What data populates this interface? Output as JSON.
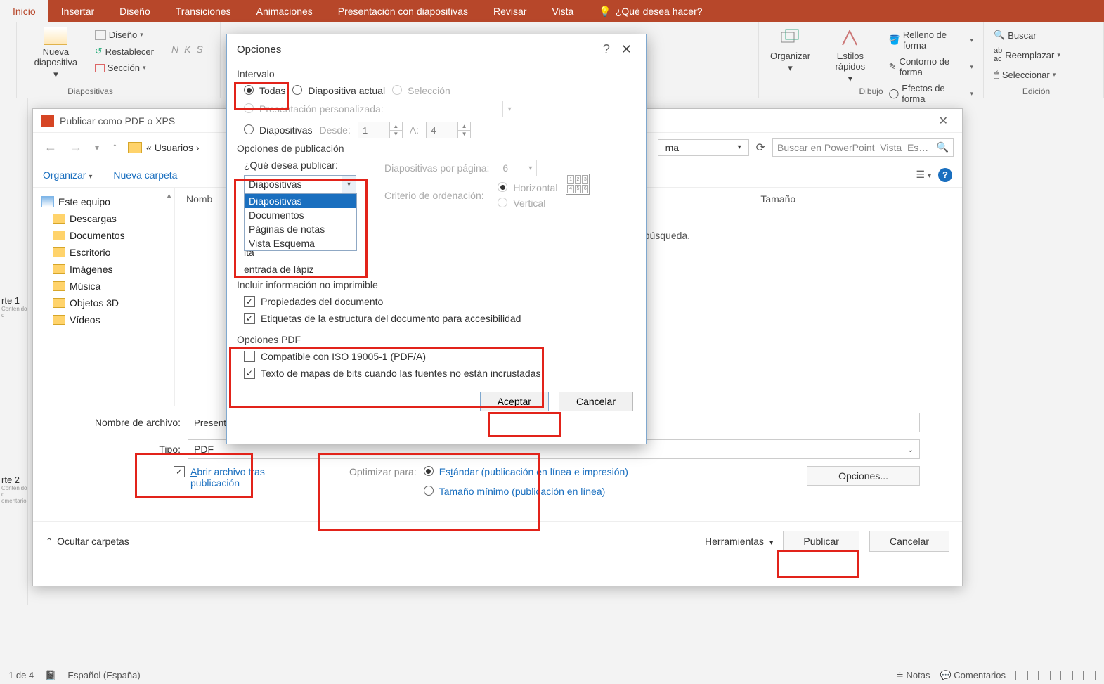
{
  "ribbon": {
    "tabs": [
      "Inicio",
      "Insertar",
      "Diseño",
      "Transiciones",
      "Animaciones",
      "Presentación con diapositivas",
      "Revisar",
      "Vista"
    ],
    "tellme": "¿Qué desea hacer?",
    "slides_group": "Diapositivas",
    "drawing_group": "Dibujo",
    "editing_group": "Edición",
    "new_slide": "Nueva diapositiva",
    "layout": "Diseño",
    "reset": "Restablecer",
    "section": "Sección",
    "organize": "Organizar",
    "quick_styles": "Estilos rápidos",
    "shape_fill": "Relleno de forma",
    "shape_outline": "Contorno de forma",
    "shape_effects": "Efectos de forma",
    "find": "Buscar",
    "replace": "Reemplazar",
    "select": "Seleccionar"
  },
  "status": {
    "slide_count": "1 de 4",
    "language": "Español (España)",
    "notes": "Notas",
    "comments": "Comentarios"
  },
  "panel": {
    "part1": "rte 1",
    "part1_sub": "Contenido d",
    "part2": "rte 2",
    "part2_sub": "Contenido d\nomentarios"
  },
  "publish": {
    "title": "Publicar como PDF o XPS",
    "crumb": "« Usuarios ›",
    "search_placeholder": "Buscar en PowerPoint_Vista_Es…",
    "organize": "Organizar",
    "new_folder": "Nueva carpeta",
    "col_name": "Nomb",
    "col_size": "Tamaño",
    "no_results": "e búsqueda.",
    "tree": {
      "pc": "Este equipo",
      "downloads": "Descargas",
      "documents": "Documentos",
      "desktop": "Escritorio",
      "pictures": "Imágenes",
      "music": "Música",
      "objects3d": "Objetos 3D",
      "videos": "Vídeos"
    },
    "filename_label": "Nombre de archivo:",
    "filename_value": "Presentación",
    "type_label": "Tipo:",
    "type_value": "PDF",
    "open_after": "Abrir archivo tras publicación",
    "optimize_for": "Optimizar para:",
    "standard": "Estándar (publicación en línea e impresión)",
    "minimum": "Tamaño mínimo (publicación en línea)",
    "options_btn": "Opciones...",
    "hide_folders": "Ocultar carpetas",
    "tools": "Herramientas",
    "publish_btn": "Publicar",
    "cancel_btn": "Cancelar",
    "format_combo": "ma"
  },
  "options": {
    "title": "Opciones",
    "range": "Intervalo",
    "all": "Todas",
    "current": "Diapositiva actual",
    "selection": "Selección",
    "custom_show": "Presentación personalizada:",
    "slides": "Diapositivas",
    "from": "Desde:",
    "from_val": "1",
    "to": "A:",
    "to_val": "4",
    "pub_options": "Opciones de publicación",
    "what_publish": "¿Qué desea publicar:",
    "combo_value": "Diapositivas",
    "combo_items": [
      "Diapositivas",
      "Documentos",
      "Páginas de notas",
      "Vista Esquema"
    ],
    "slides_per_page": "Diapositivas por página:",
    "spp_value": "6",
    "order": "Criterio de ordenación:",
    "horizontal": "Horizontal",
    "vertical": "Vertical",
    "hidden_tail": "lta",
    "ink_tail": "entrada de lápiz",
    "nonprint": "Incluir información no imprimible",
    "doc_props": "Propiedades del documento",
    "struct_tags": "Etiquetas de la estructura del documento para accesibilidad",
    "pdf_opts": "Opciones PDF",
    "iso": "Compatible con ISO 19005-1 (PDF/A)",
    "bitmap": "Texto de mapas de bits cuando las fuentes no están incrustadas",
    "accept": "Aceptar",
    "cancel": "Cancelar"
  }
}
